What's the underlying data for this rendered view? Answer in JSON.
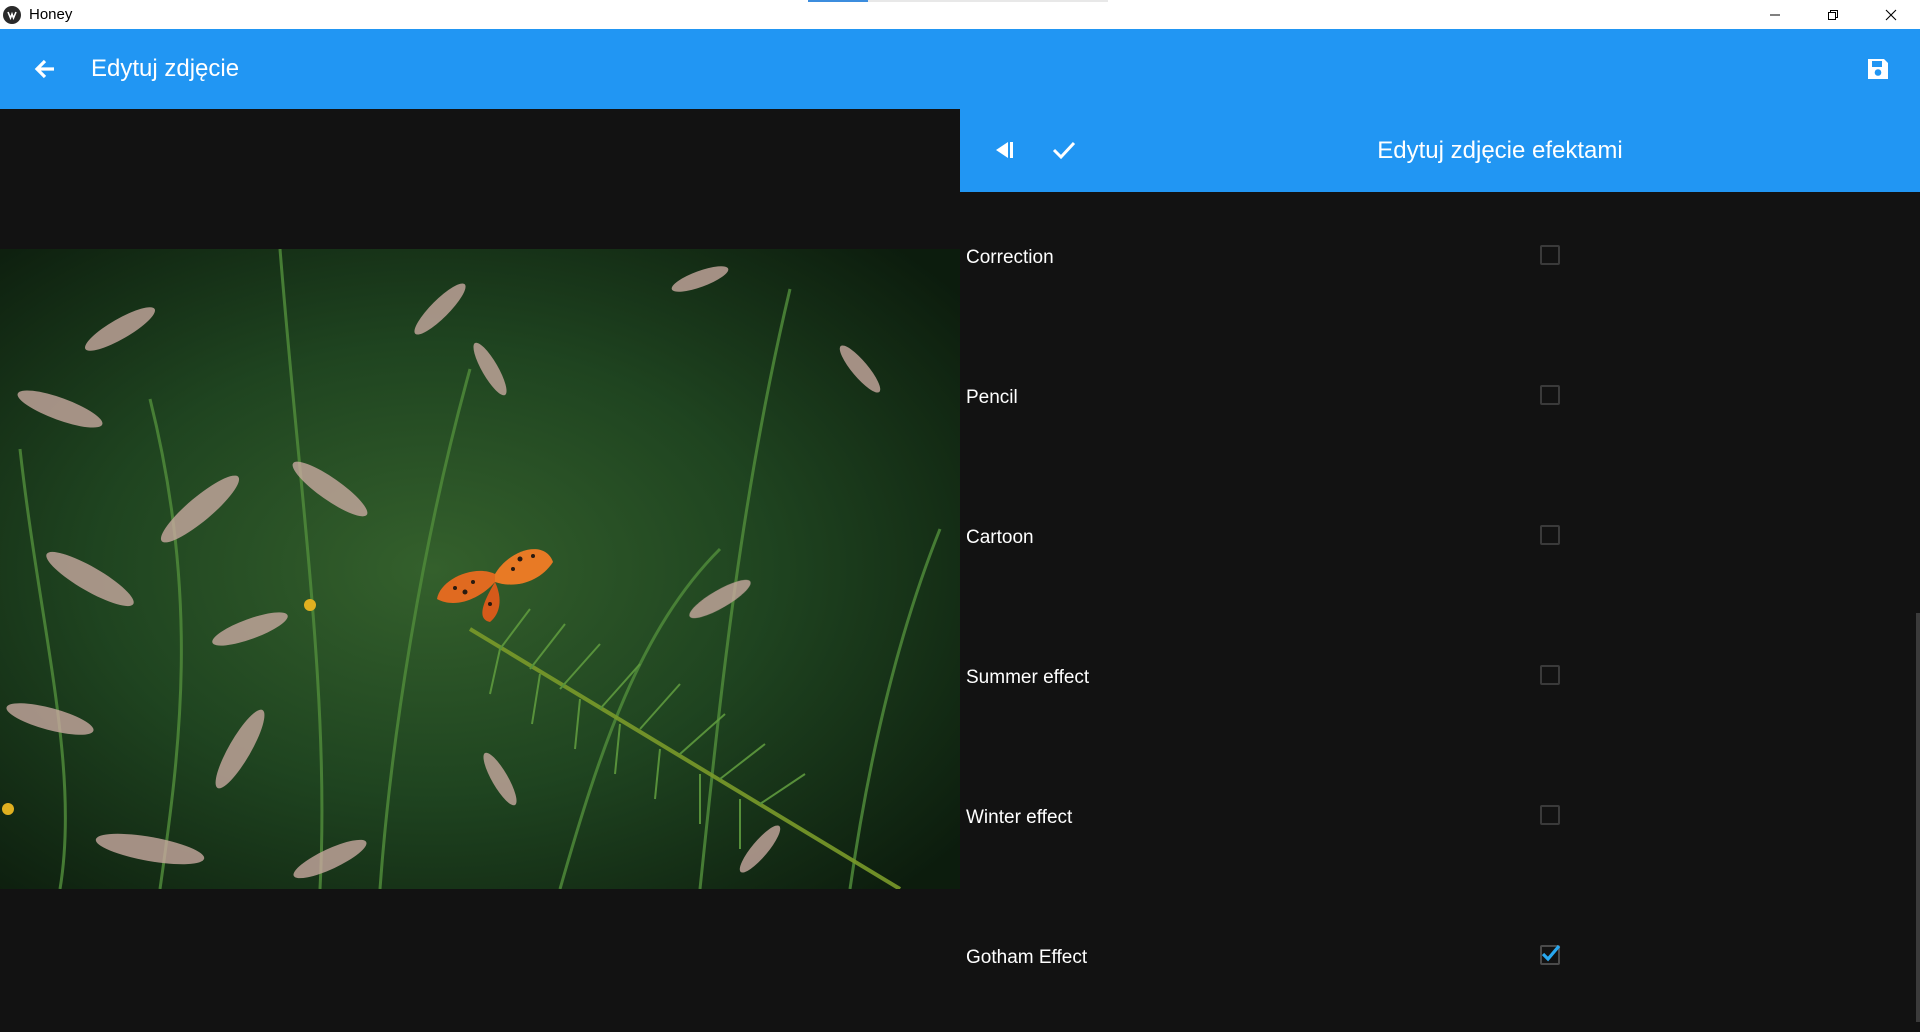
{
  "window": {
    "app_title": "Honey",
    "controls": [
      "minimize-icon",
      "restore-icon",
      "close-icon"
    ]
  },
  "appbar": {
    "title": "Edytuj zdjęcie",
    "back_icon": "arrow-left-icon",
    "save_icon": "floppy-save-icon",
    "color": "#2196f3"
  },
  "effects_panel": {
    "title": "Edytuj zdjęcie efektami",
    "collapse_icon": "collapse-panel-icon",
    "apply_icon": "checkmark-icon",
    "items": [
      {
        "label": "Correction",
        "checked": false
      },
      {
        "label": "Pencil",
        "checked": false
      },
      {
        "label": "Cartoon",
        "checked": false
      },
      {
        "label": "Summer effect",
        "checked": false
      },
      {
        "label": "Winter effect",
        "checked": false
      },
      {
        "label": "Gotham Effect",
        "checked": true
      }
    ]
  },
  "colors": {
    "accent": "#2196f3",
    "background": "#121212",
    "check": "#29a8f0"
  }
}
